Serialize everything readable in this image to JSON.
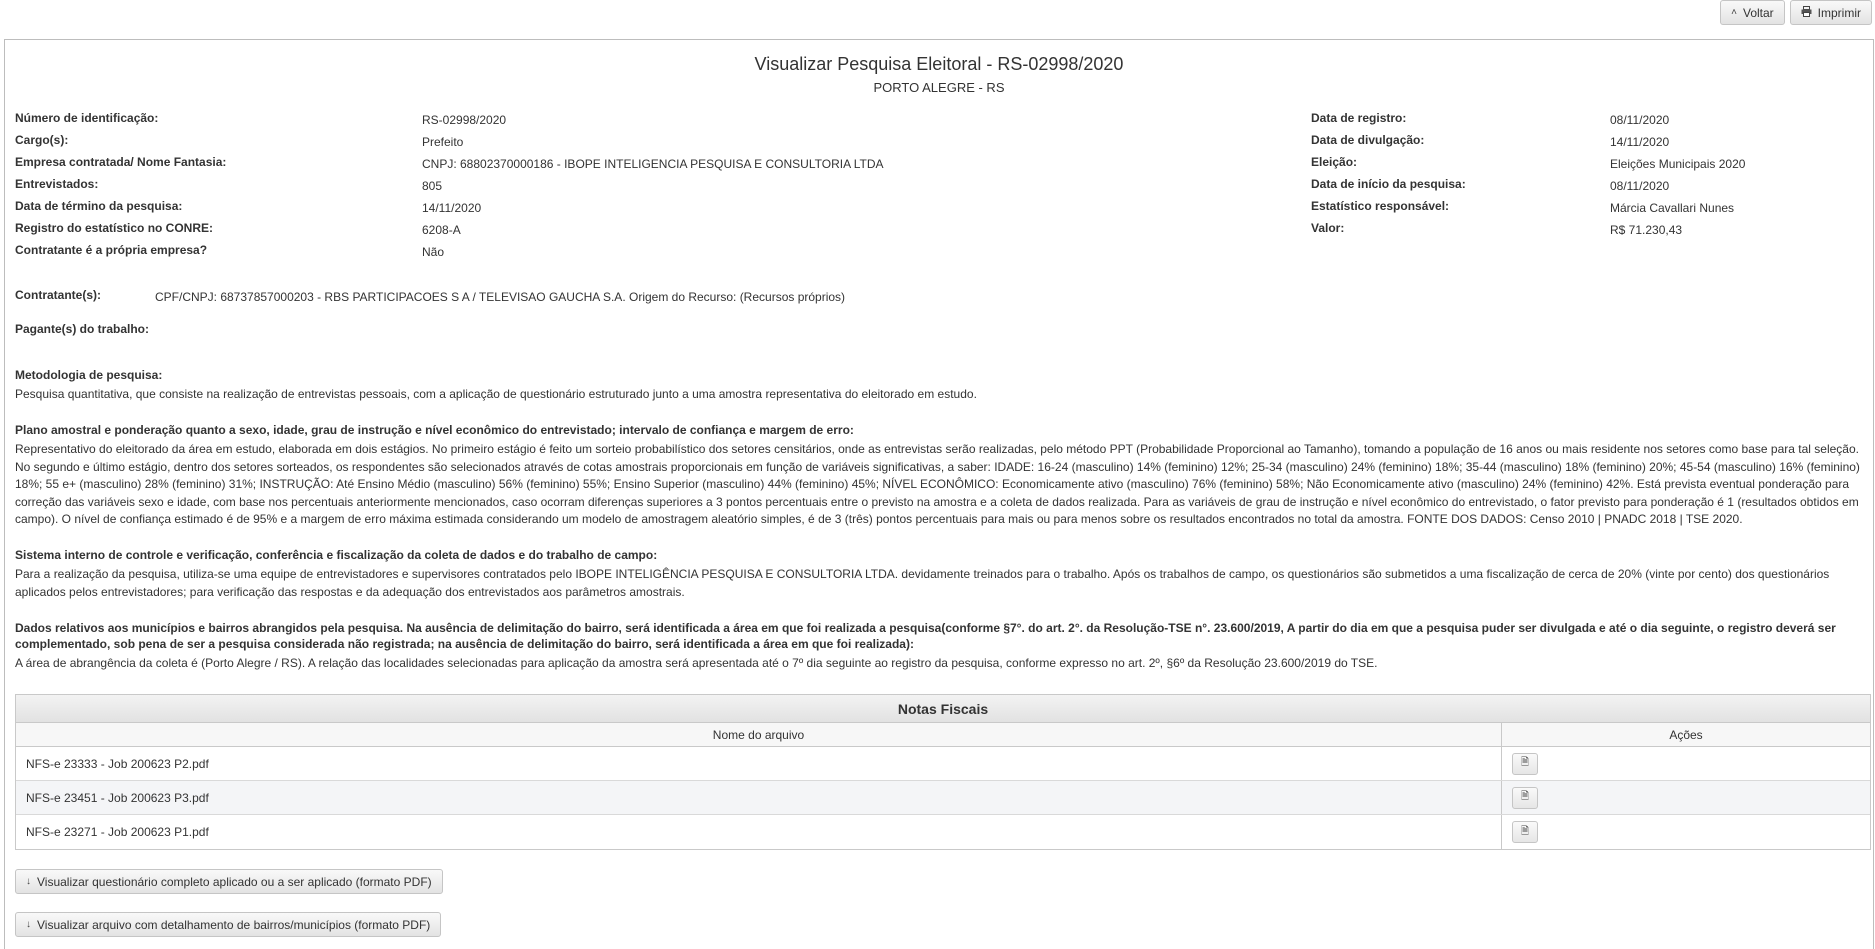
{
  "topbar": {
    "back_label": "Voltar",
    "back_icon": "chevron-up-icon",
    "print_label": "Imprimir",
    "print_icon": "printer-icon"
  },
  "header": {
    "title": "Visualizar Pesquisa Eleitoral - RS-02998/2020",
    "subtitle": "PORTO ALEGRE - RS"
  },
  "info_left": [
    {
      "label": "Número de identificação:",
      "value": "RS-02998/2020"
    },
    {
      "label": "Cargo(s):",
      "value": "Prefeito"
    },
    {
      "label": "Empresa contratada/ Nome Fantasia:",
      "value": "CNPJ: 68802370000186 - IBOPE INTELIGENCIA PESQUISA E CONSULTORIA LTDA"
    },
    {
      "label": "Entrevistados:",
      "value": "805"
    },
    {
      "label": "Data de término da pesquisa:",
      "value": "14/11/2020"
    },
    {
      "label": "Registro do estatístico no CONRE:",
      "value": "6208-A"
    },
    {
      "label": "Contratante é a própria empresa?",
      "value": "Não"
    }
  ],
  "info_right": [
    {
      "label": "Data de registro:",
      "value": "08/11/2020"
    },
    {
      "label": "Data de divulgação:",
      "value": "14/11/2020"
    },
    {
      "label": "Eleição:",
      "value": "Eleições Municipais 2020"
    },
    {
      "label": "Data de início da pesquisa:",
      "value": "08/11/2020"
    },
    {
      "label": "Estatístico responsável:",
      "value": "Márcia Cavallari Nunes"
    },
    {
      "label": "Valor:",
      "value": "R$ 71.230,43"
    }
  ],
  "contratante": {
    "label": "Contratante(s):",
    "value": "CPF/CNPJ: 68737857000203 - RBS PARTICIPACOES S A / TELEVISAO GAUCHA S.A. Origem do Recurso: (Recursos próprios)"
  },
  "pagante": {
    "label": "Pagante(s) do trabalho:"
  },
  "sections": [
    {
      "title": "Metodologia de pesquisa:",
      "text": "Pesquisa quantitativa, que consiste na realização de entrevistas pessoais, com a aplicação de questionário estruturado junto a uma amostra representativa do eleitorado em estudo."
    },
    {
      "title": "Plano amostral e ponderação quanto a sexo, idade, grau de instrução e nível econômico do entrevistado; intervalo de confiança e margem de erro:",
      "text": "Representativo do eleitorado da área em estudo, elaborada em dois estágios. No primeiro estágio é feito um sorteio probabilístico dos setores censitários, onde as entrevistas serão realizadas, pelo método PPT (Probabilidade Proporcional ao Tamanho), tomando a população de 16 anos ou mais residente nos setores como base para tal seleção. No segundo e último estágio, dentro dos setores sorteados, os respondentes são selecionados através de cotas amostrais proporcionais em função de variáveis significativas, a saber: IDADE: 16-24 (masculino) 14% (feminino) 12%; 25-34 (masculino) 24% (feminino) 18%; 35-44 (masculino) 18% (feminino) 20%; 45-54 (masculino) 16% (feminino) 18%; 55 e+ (masculino) 28% (feminino) 31%; INSTRUÇÃO: Até Ensino Médio (masculino) 56% (feminino) 55%; Ensino Superior (masculino) 44% (feminino) 45%; NÍVEL ECONÔMICO: Economicamente ativo (masculino) 76% (feminino) 58%; Não Economicamente ativo (masculino) 24% (feminino) 42%. Está prevista eventual ponderação para correção das variáveis sexo e idade, com base nos percentuais anteriormente mencionados, caso ocorram diferenças superiores a 3 pontos percentuais entre o previsto na amostra e a coleta de dados realizada. Para as variáveis de grau de instrução e nível econômico do entrevistado, o fator previsto para ponderação é 1 (resultados obtidos em campo). O nível de confiança estimado é de 95% e a margem de erro máxima estimada considerando um modelo de amostragem aleatório simples, é de 3 (três) pontos percentuais para mais ou para menos sobre os resultados encontrados no total da amostra. FONTE DOS DADOS: Censo 2010 | PNADC 2018 | TSE 2020."
    },
    {
      "title": "Sistema interno de controle e verificação, conferência e fiscalização da coleta de dados e do trabalho de campo:",
      "text": "Para a realização da pesquisa, utiliza-se uma equipe de entrevistadores e supervisores contratados pelo IBOPE INTELIGÊNCIA PESQUISA E CONSULTORIA LTDA. devidamente treinados para o trabalho. Após os trabalhos de campo, os questionários são submetidos a uma fiscalização de cerca de 20% (vinte por cento) dos questionários aplicados pelos entrevistadores; para verificação das respostas e da adequação dos entrevistados aos parâmetros amostrais."
    },
    {
      "title": "Dados relativos aos municípios e bairros abrangidos pela pesquisa. Na ausência de delimitação do bairro, será identificada a área em que foi realizada a pesquisa(conforme §7°. do art. 2°. da Resolução-TSE n°. 23.600/2019, A partir do dia em que a pesquisa puder ser divulgada e até o dia seguinte, o registro deverá ser complementado, sob pena de ser a pesquisa considerada não registrada; na ausência de delimitação do bairro, será identificada a área em que foi realizada):",
      "text": "A área de abrangência da coleta é (Porto Alegre / RS). A relação das localidades selecionadas para aplicação da amostra será apresentada até o 7º dia seguinte ao registro da pesquisa, conforme expresso no art. 2º, §6º da Resolução 23.600/2019 do TSE."
    }
  ],
  "notas_fiscais": {
    "caption": "Notas Fiscais",
    "col_file": "Nome do arquivo",
    "col_actions": "Ações",
    "rows": [
      {
        "file": "NFS-e 23333 - Job 200623 P2.pdf",
        "action_icon": "file-icon"
      },
      {
        "file": "NFS-e 23451 - Job 200623 P3.pdf",
        "action_icon": "file-icon"
      },
      {
        "file": "NFS-e 23271 - Job 200623 P1.pdf",
        "action_icon": "file-icon"
      }
    ]
  },
  "downloads": {
    "questionario": "Visualizar questionário completo aplicado ou a ser aplicado (formato PDF)",
    "bairros": "Visualizar arquivo com detalhamento de bairros/municípios (formato PDF)",
    "icon": "arrow-down-icon"
  }
}
